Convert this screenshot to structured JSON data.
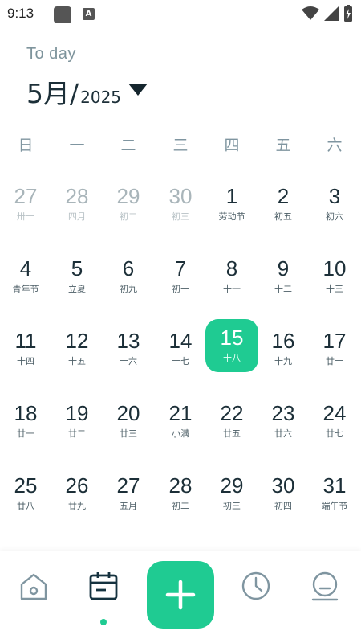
{
  "status_bar": {
    "time": "9:13",
    "notif_letter": "A"
  },
  "header": {
    "today_label": "To day",
    "month": "5月/",
    "year": "2025"
  },
  "weekdays": [
    "日",
    "一",
    "二",
    "三",
    "四",
    "五",
    "六"
  ],
  "calendar": {
    "rows": [
      [
        {
          "day": "27",
          "lunar": "卅十",
          "muted": true
        },
        {
          "day": "28",
          "lunar": "四月",
          "muted": true
        },
        {
          "day": "29",
          "lunar": "初二",
          "muted": true
        },
        {
          "day": "30",
          "lunar": "初三",
          "muted": true
        },
        {
          "day": "1",
          "lunar": "劳动节"
        },
        {
          "day": "2",
          "lunar": "初五"
        },
        {
          "day": "3",
          "lunar": "初六"
        }
      ],
      [
        {
          "day": "4",
          "lunar": "青年节"
        },
        {
          "day": "5",
          "lunar": "立夏"
        },
        {
          "day": "6",
          "lunar": "初九"
        },
        {
          "day": "7",
          "lunar": "初十"
        },
        {
          "day": "8",
          "lunar": "十一"
        },
        {
          "day": "9",
          "lunar": "十二"
        },
        {
          "day": "10",
          "lunar": "十三"
        }
      ],
      [
        {
          "day": "11",
          "lunar": "十四"
        },
        {
          "day": "12",
          "lunar": "十五"
        },
        {
          "day": "13",
          "lunar": "十六"
        },
        {
          "day": "14",
          "lunar": "十七"
        },
        {
          "day": "15",
          "lunar": "十八",
          "today": true
        },
        {
          "day": "16",
          "lunar": "十九"
        },
        {
          "day": "17",
          "lunar": "廿十"
        }
      ],
      [
        {
          "day": "18",
          "lunar": "廿一"
        },
        {
          "day": "19",
          "lunar": "廿二"
        },
        {
          "day": "20",
          "lunar": "廿三"
        },
        {
          "day": "21",
          "lunar": "小满"
        },
        {
          "day": "22",
          "lunar": "廿五"
        },
        {
          "day": "23",
          "lunar": "廿六"
        },
        {
          "day": "24",
          "lunar": "廿七"
        }
      ],
      [
        {
          "day": "25",
          "lunar": "廿八"
        },
        {
          "day": "26",
          "lunar": "廿九"
        },
        {
          "day": "27",
          "lunar": "五月"
        },
        {
          "day": "28",
          "lunar": "初二"
        },
        {
          "day": "29",
          "lunar": "初三"
        },
        {
          "day": "30",
          "lunar": "初四"
        },
        {
          "day": "31",
          "lunar": "端午节"
        }
      ]
    ]
  },
  "bottom_nav": {
    "items": [
      {
        "icon": "home-icon"
      },
      {
        "icon": "calendar-icon",
        "active": true
      },
      {
        "icon": "clock-icon"
      },
      {
        "icon": "profile-icon"
      }
    ],
    "fab_icon": "plus-icon"
  },
  "colors": {
    "accent": "#1fcb92",
    "text": "#1c2f38",
    "muted": "#a9b5ba",
    "weekday": "#7f95a0"
  }
}
